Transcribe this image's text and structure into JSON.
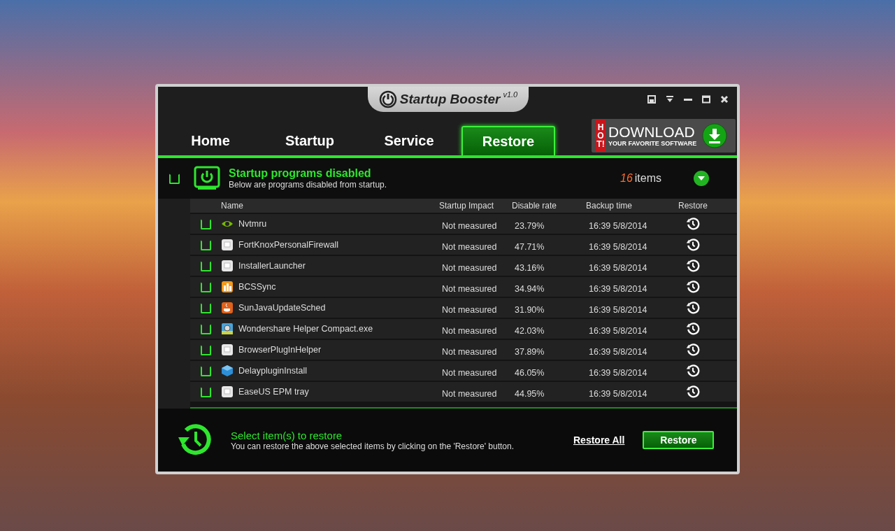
{
  "window": {
    "title": "Startup Booster",
    "version": "v1.0"
  },
  "tabs": [
    {
      "label": "Home",
      "selected": false
    },
    {
      "label": "Startup",
      "selected": false
    },
    {
      "label": "Service",
      "selected": false
    },
    {
      "label": "Restore",
      "selected": true
    }
  ],
  "banner": {
    "badge": "HOT!",
    "title": "DOWNLOAD",
    "subtitle": "YOUR FAVORITE SOFTWARE"
  },
  "section": {
    "checked": false,
    "title": "Startup programs disabled",
    "subtitle": "Below are programs disabled from startup.",
    "count": "16",
    "count_label": "items"
  },
  "table": {
    "columns": [
      "Name",
      "Startup Impact",
      "Disable rate",
      "Backup time",
      "Restore"
    ],
    "rows": [
      {
        "checked": false,
        "kind": "chip",
        "name": "Nvtmru",
        "impact": "Not measured",
        "rate": "23.79%",
        "time": "16:39 5/8/2014"
      },
      {
        "checked": false,
        "kind": "generic",
        "name": "FortKnoxPersonalFirewall",
        "impact": "Not measured",
        "rate": "47.71%",
        "time": "16:39 5/8/2014"
      },
      {
        "checked": false,
        "kind": "generic",
        "name": "InstallerLauncher",
        "impact": "Not measured",
        "rate": "43.16%",
        "time": "16:39 5/8/2014"
      },
      {
        "checked": false,
        "kind": "bars",
        "name": "BCSSync",
        "impact": "Not measured",
        "rate": "34.94%",
        "time": "16:39 5/8/2014"
      },
      {
        "checked": false,
        "kind": "cup",
        "name": "SunJavaUpdateSched",
        "impact": "Not measured",
        "rate": "31.90%",
        "time": "16:39 5/8/2014"
      },
      {
        "checked": false,
        "kind": "camera",
        "name": "Wondershare Helper Compact.exe",
        "impact": "Not measured",
        "rate": "42.03%",
        "time": "16:39 5/8/2014"
      },
      {
        "checked": false,
        "kind": "generic",
        "name": "BrowserPlugInHelper",
        "impact": "Not measured",
        "rate": "37.89%",
        "time": "16:39 5/8/2014"
      },
      {
        "checked": false,
        "kind": "cube",
        "name": "DelaypluginInstall",
        "impact": "Not measured",
        "rate": "46.05%",
        "time": "16:39 5/8/2014"
      },
      {
        "checked": false,
        "kind": "generic",
        "name": "EaseUS EPM tray",
        "impact": "Not measured",
        "rate": "44.95%",
        "time": "16:39 5/8/2014"
      }
    ]
  },
  "footer": {
    "title": "Select item(s) to restore",
    "text": "You can restore the above selected items by clicking on the 'Restore' button.",
    "link": "Restore All",
    "button": "Restore"
  }
}
